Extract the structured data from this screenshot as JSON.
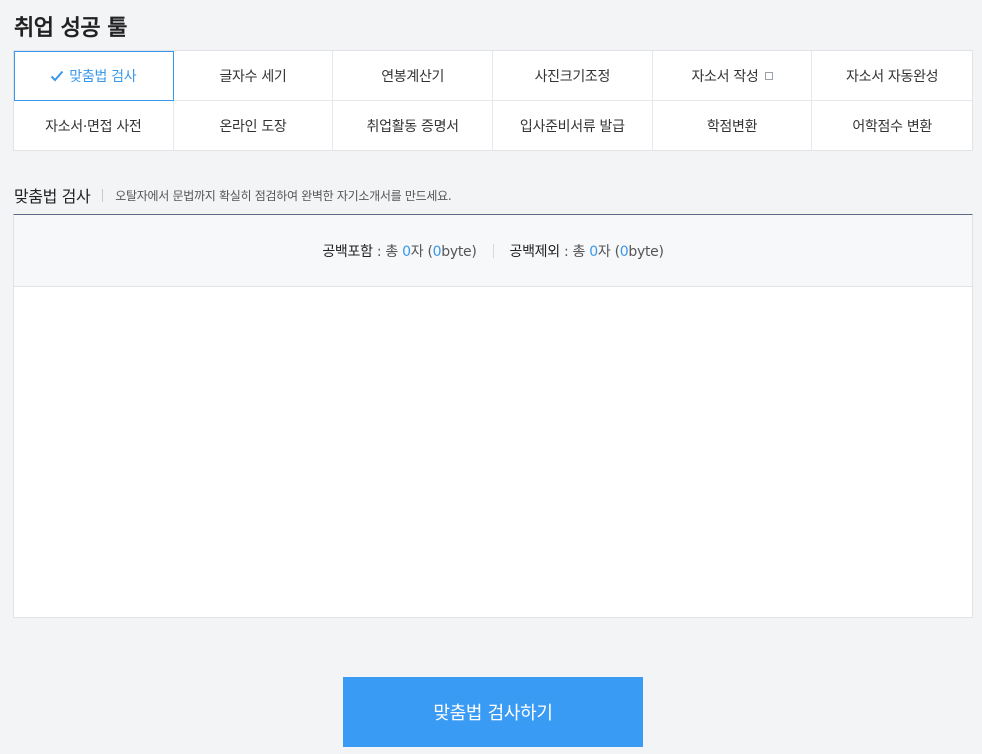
{
  "page_title": "취업 성공 툴",
  "tools": [
    {
      "label": "맞춤법 검사",
      "active": true,
      "icon": "check-icon"
    },
    {
      "label": "글자수 세기"
    },
    {
      "label": "연봉계산기"
    },
    {
      "label": "사진크기조정"
    },
    {
      "label": "자소서 작성",
      "icon": "external-link-icon"
    },
    {
      "label": "자소서 자동완성"
    },
    {
      "label": "자소서·면접 사전"
    },
    {
      "label": "온라인 도장"
    },
    {
      "label": "취업활동 증명서"
    },
    {
      "label": "입사준비서류 발급"
    },
    {
      "label": "학점변환"
    },
    {
      "label": "어학점수 변환"
    }
  ],
  "section": {
    "title": "맞춤법 검사",
    "description": "오탈자에서 문법까지 확실히 점검하여 완벽한 자기소개서를 만드세요."
  },
  "counter": {
    "with_spaces_label": "공백포함",
    "without_spaces_label": "공백제외",
    "total_prefix": " : 총 ",
    "with_spaces_chars": "0",
    "with_spaces_bytes": "0",
    "without_spaces_chars": "0",
    "without_spaces_bytes": "0",
    "char_unit": "자",
    "byte_open": " (",
    "byte_close": "byte)"
  },
  "editor": {
    "value": "",
    "placeholder": ""
  },
  "submit_label": "맞춤법 검사하기",
  "colors": {
    "accent": "#3898ec",
    "button": "#3a9bf5",
    "background": "#f3f4f6"
  }
}
